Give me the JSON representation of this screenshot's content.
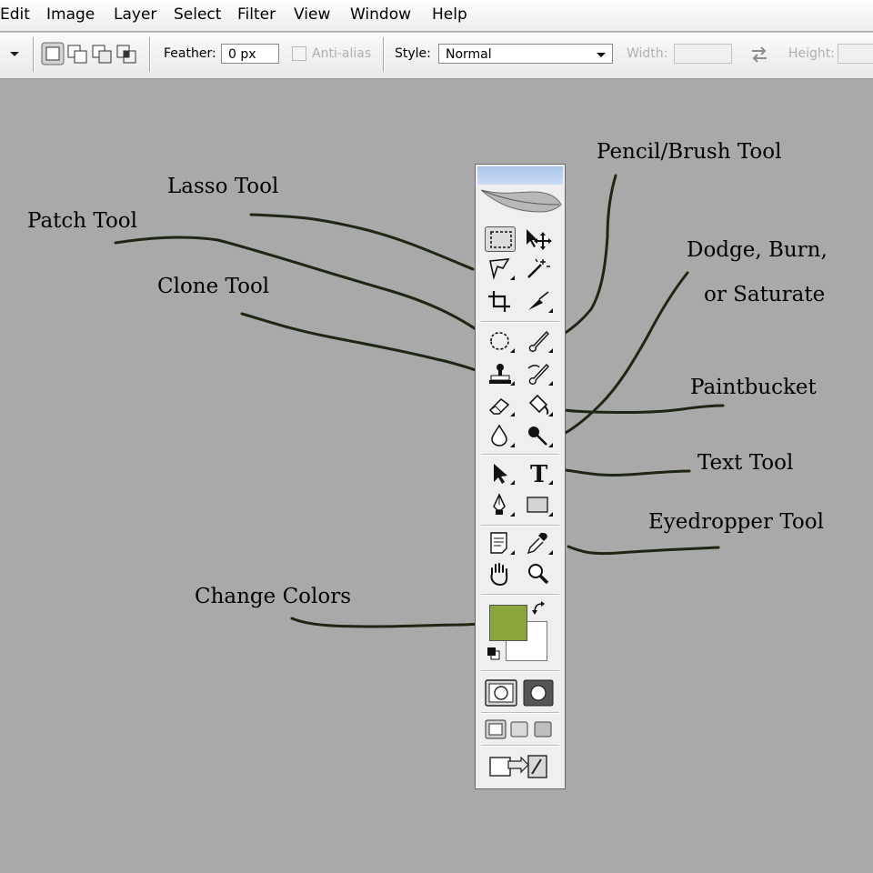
{
  "menubar": {
    "items": [
      "Edit",
      "Image",
      "Layer",
      "Select",
      "Filter",
      "View",
      "Window",
      "Help"
    ]
  },
  "options": {
    "feather_label": "Feather:",
    "feather_value": "0 px",
    "antialias_label": "Anti-alias",
    "style_label": "Style:",
    "style_value": "Normal",
    "width_label": "Width:",
    "height_label": "Height:"
  },
  "annotations": {
    "pencil_brush": "Pencil/Brush Tool",
    "lasso": "Lasso Tool",
    "patch": "Patch Tool",
    "dodge_line1": "Dodge, Burn,",
    "dodge_line2": "or Saturate",
    "clone": "Clone Tool",
    "paintbucket": "Paintbucket",
    "text": "Text Tool",
    "eyedropper": "Eyedropper Tool",
    "change_colors": "Change Colors"
  },
  "colors": {
    "foreground": "#8aa63a",
    "background": "#ffffff",
    "canvas": "#a9a9a9",
    "leader_line": "#1e2614"
  },
  "toolbox": {
    "tools": [
      "rectangular-marquee-icon",
      "move-icon",
      "lasso-icon",
      "magic-wand-icon",
      "crop-icon",
      "slice-icon",
      "healing-patch-icon",
      "brush-icon",
      "clone-stamp-icon",
      "history-brush-icon",
      "eraser-icon",
      "paint-bucket-icon",
      "blur-icon",
      "dodge-icon",
      "path-selection-icon",
      "type-icon",
      "pen-icon",
      "rectangle-shape-icon",
      "notes-icon",
      "eyedropper-icon",
      "hand-icon",
      "zoom-icon"
    ],
    "type_glyph": "T"
  }
}
